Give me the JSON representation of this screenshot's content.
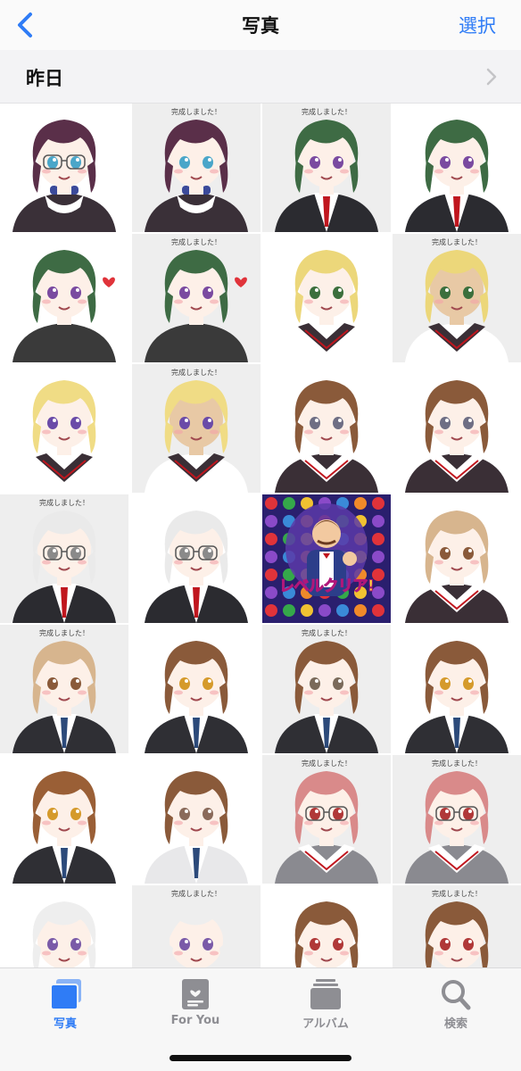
{
  "nav": {
    "title": "写真",
    "select_label": "選択",
    "back_icon": "chevron-left-icon"
  },
  "section": {
    "title": "昨日",
    "chevron_icon": "chevron-right-icon"
  },
  "colors": {
    "accent": "#2f7cf6",
    "inactive": "#8e8e93"
  },
  "caption_text": "完成しました！",
  "photos": [
    {
      "hair": "#5a2f49",
      "eye": "#4aa6c9",
      "outfit": "maid",
      "skin": "#fdf0e8",
      "bg": "#ffffff",
      "caption": "",
      "glasses": true
    },
    {
      "hair": "#5a2f49",
      "eye": "#4aa6c9",
      "outfit": "maid",
      "skin": "#fdf0e8",
      "bg": "#eeeeee",
      "caption": "完成しました！",
      "glasses": false
    },
    {
      "hair": "#3e6b44",
      "eye": "#7a4aa0",
      "outfit": "blazer",
      "skin": "#fdf0e8",
      "bg": "#eeeeee",
      "caption": "完成しました！",
      "glasses": false
    },
    {
      "hair": "#3e6b44",
      "eye": "#7a4aa0",
      "outfit": "blazer",
      "skin": "#fdf0e8",
      "bg": "#ffffff",
      "caption": "",
      "glasses": false
    },
    {
      "hair": "#3e6b44",
      "eye": "#7a4aa0",
      "outfit": "sweater",
      "skin": "#fdf0e8",
      "bg": "#ffffff",
      "caption": "",
      "glasses": false,
      "heart": true
    },
    {
      "hair": "#3e6b44",
      "eye": "#7a4aa0",
      "outfit": "sweater",
      "skin": "#fdf0e8",
      "bg": "#eeeeee",
      "caption": "完成しました！",
      "glasses": false,
      "heart": true
    },
    {
      "hair": "#ecd77a",
      "eye": "#3b6f3c",
      "outfit": "sailor",
      "skin": "#fdf0e8",
      "bg": "#ffffff",
      "caption": "",
      "glasses": false
    },
    {
      "hair": "#ecd77a",
      "eye": "#3b6f3c",
      "outfit": "sailor",
      "skin": "#e8c9a5",
      "bg": "#eeeeee",
      "caption": "完成しました！",
      "glasses": false
    },
    {
      "hair": "#f0dc85",
      "eye": "#6a4aa8",
      "outfit": "sailor",
      "skin": "#fdf0e8",
      "bg": "#ffffff",
      "caption": "",
      "glasses": false
    },
    {
      "hair": "#f0dc85",
      "eye": "#6a4aa8",
      "outfit": "sailor",
      "skin": "#e8c9a5",
      "bg": "#eeeeee",
      "caption": "完成しました！",
      "glasses": false
    },
    {
      "hair": "#8a5a3a",
      "eye": "#6e6e84",
      "outfit": "sailor-dark",
      "skin": "#fdf0e8",
      "bg": "#ffffff",
      "caption": "",
      "glasses": false
    },
    {
      "hair": "#8a5a3a",
      "eye": "#6e6e84",
      "outfit": "sailor-dark",
      "skin": "#fdf0e8",
      "bg": "#ffffff",
      "caption": "",
      "glasses": false
    },
    {
      "hair": "#eaeaea",
      "eye": "#8a8a8a",
      "outfit": "blazer",
      "skin": "#fdf0e8",
      "bg": "#eeeeee",
      "caption": "完成しました！",
      "glasses": true
    },
    {
      "hair": "#eaeaea",
      "eye": "#8a8a8a",
      "outfit": "blazer",
      "skin": "#fdf0e8",
      "bg": "#ffffff",
      "caption": "",
      "glasses": true
    },
    {
      "game": true,
      "banner": "レベルクリア!"
    },
    {
      "hair": "#d7b58e",
      "eye": "#8a5a3a",
      "outfit": "sailor-dark",
      "skin": "#fdf0e8",
      "bg": "#ffffff",
      "caption": "",
      "glasses": false
    },
    {
      "hair": "#d7b58e",
      "eye": "#8a5a3a",
      "outfit": "vest",
      "skin": "#fdf0e8",
      "bg": "#eeeeee",
      "caption": "完成しました！",
      "glasses": false
    },
    {
      "hair": "#8a5a3a",
      "eye": "#d59a2b",
      "outfit": "vest",
      "skin": "#fdf0e8",
      "bg": "#ffffff",
      "caption": "",
      "glasses": false
    },
    {
      "hair": "#8a5a3a",
      "eye": "#7a6a5a",
      "outfit": "vest",
      "skin": "#fdf0e8",
      "bg": "#eeeeee",
      "caption": "完成しました！",
      "glasses": false
    },
    {
      "hair": "#8a5a3a",
      "eye": "#d59a2b",
      "outfit": "vest",
      "skin": "#fdf0e8",
      "bg": "#ffffff",
      "caption": "",
      "glasses": false
    },
    {
      "hair": "#9a5f36",
      "eye": "#d59a2b",
      "outfit": "vest",
      "skin": "#fdf0e8",
      "bg": "#ffffff",
      "caption": "",
      "glasses": false
    },
    {
      "hair": "#8a5a3a",
      "eye": "#8a6a5a",
      "outfit": "jacket",
      "skin": "#fdf0e8",
      "bg": "#ffffff",
      "caption": "",
      "glasses": false
    },
    {
      "hair": "#d98a8a",
      "eye": "#b03838",
      "outfit": "sailor-grey",
      "skin": "#fdf0e8",
      "bg": "#eeeeee",
      "caption": "完成しました！",
      "glasses": true
    },
    {
      "hair": "#d98a8a",
      "eye": "#b03838",
      "outfit": "sailor-grey",
      "skin": "#fdf0e8",
      "bg": "#eeeeee",
      "caption": "完成しました！",
      "glasses": true
    },
    {
      "hair": "#eeeeee",
      "eye": "#7a5aa8",
      "outfit": "blazer",
      "skin": "#fdf0e8",
      "bg": "#ffffff",
      "caption": "",
      "glasses": false
    },
    {
      "hair": "#eeeeee",
      "eye": "#7a5aa8",
      "outfit": "blazer",
      "skin": "#fdf0e8",
      "bg": "#eeeeee",
      "caption": "完成しました！",
      "glasses": false
    },
    {
      "hair": "#8a5a3a",
      "eye": "#b03838",
      "outfit": "sailor-dark",
      "skin": "#fdf0e8",
      "bg": "#ffffff",
      "caption": "",
      "glasses": false
    },
    {
      "hair": "#8a5a3a",
      "eye": "#b03838",
      "outfit": "sailor-dark",
      "skin": "#fdf0e8",
      "bg": "#eeeeee",
      "caption": "完成しました！",
      "glasses": false
    }
  ],
  "tabs": [
    {
      "label": "写真",
      "icon": "photos-library-icon",
      "active": true
    },
    {
      "label": "For You",
      "icon": "for-you-icon",
      "active": false
    },
    {
      "label": "アルバム",
      "icon": "albums-icon",
      "active": false
    },
    {
      "label": "検索",
      "icon": "search-icon",
      "active": false
    }
  ]
}
